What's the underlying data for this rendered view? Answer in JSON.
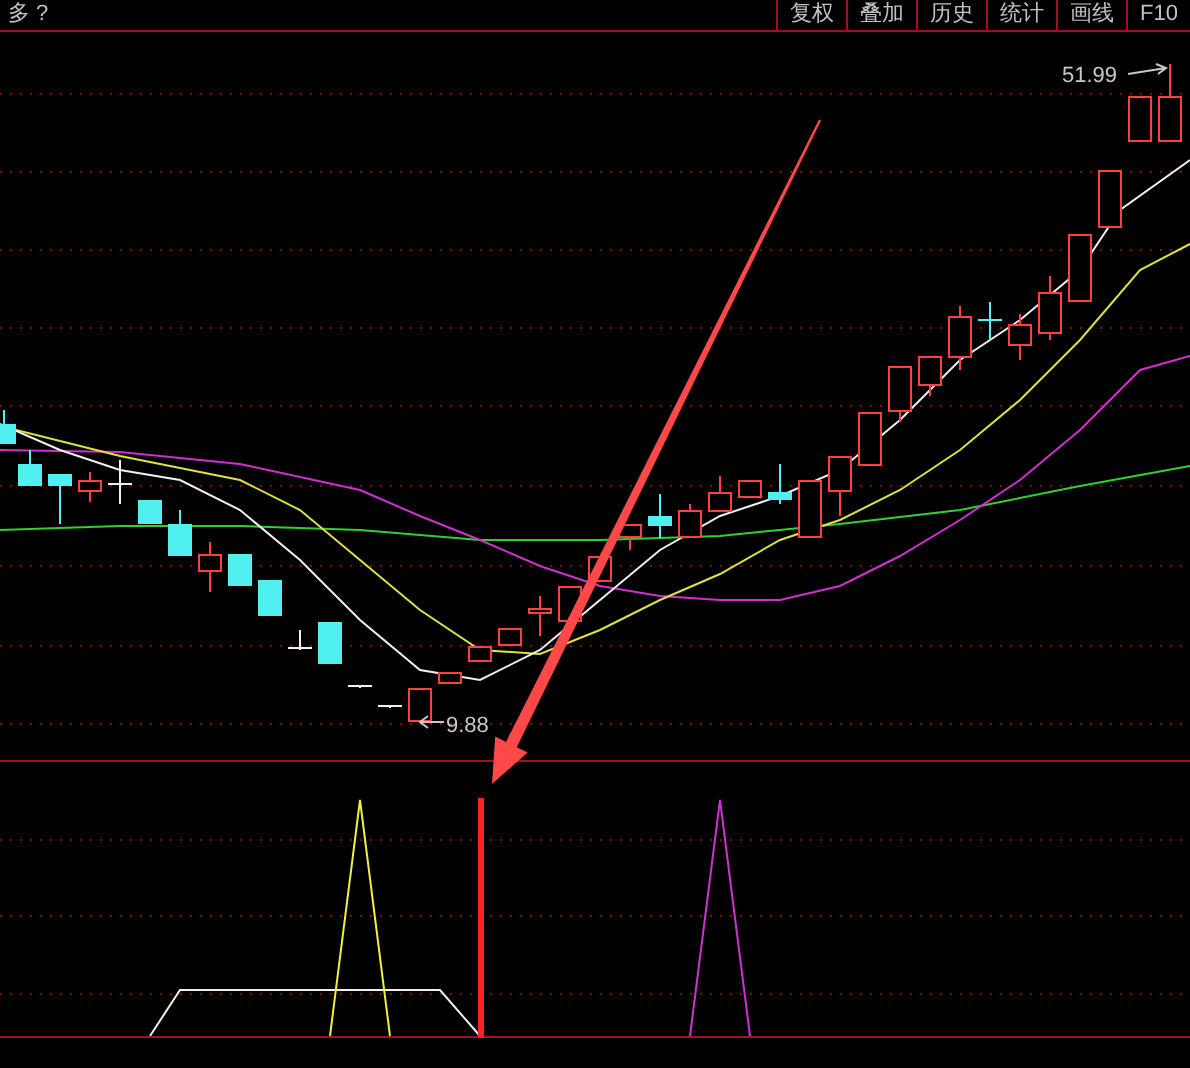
{
  "title": "多 ?",
  "toolbar": [
    {
      "label": "复权"
    },
    {
      "label": "叠加"
    },
    {
      "label": "历史"
    },
    {
      "label": "统计"
    },
    {
      "label": "画线"
    },
    {
      "label": "F10"
    }
  ],
  "price_chart": {
    "high_label": "51.99",
    "low_label": "9.88"
  }
}
